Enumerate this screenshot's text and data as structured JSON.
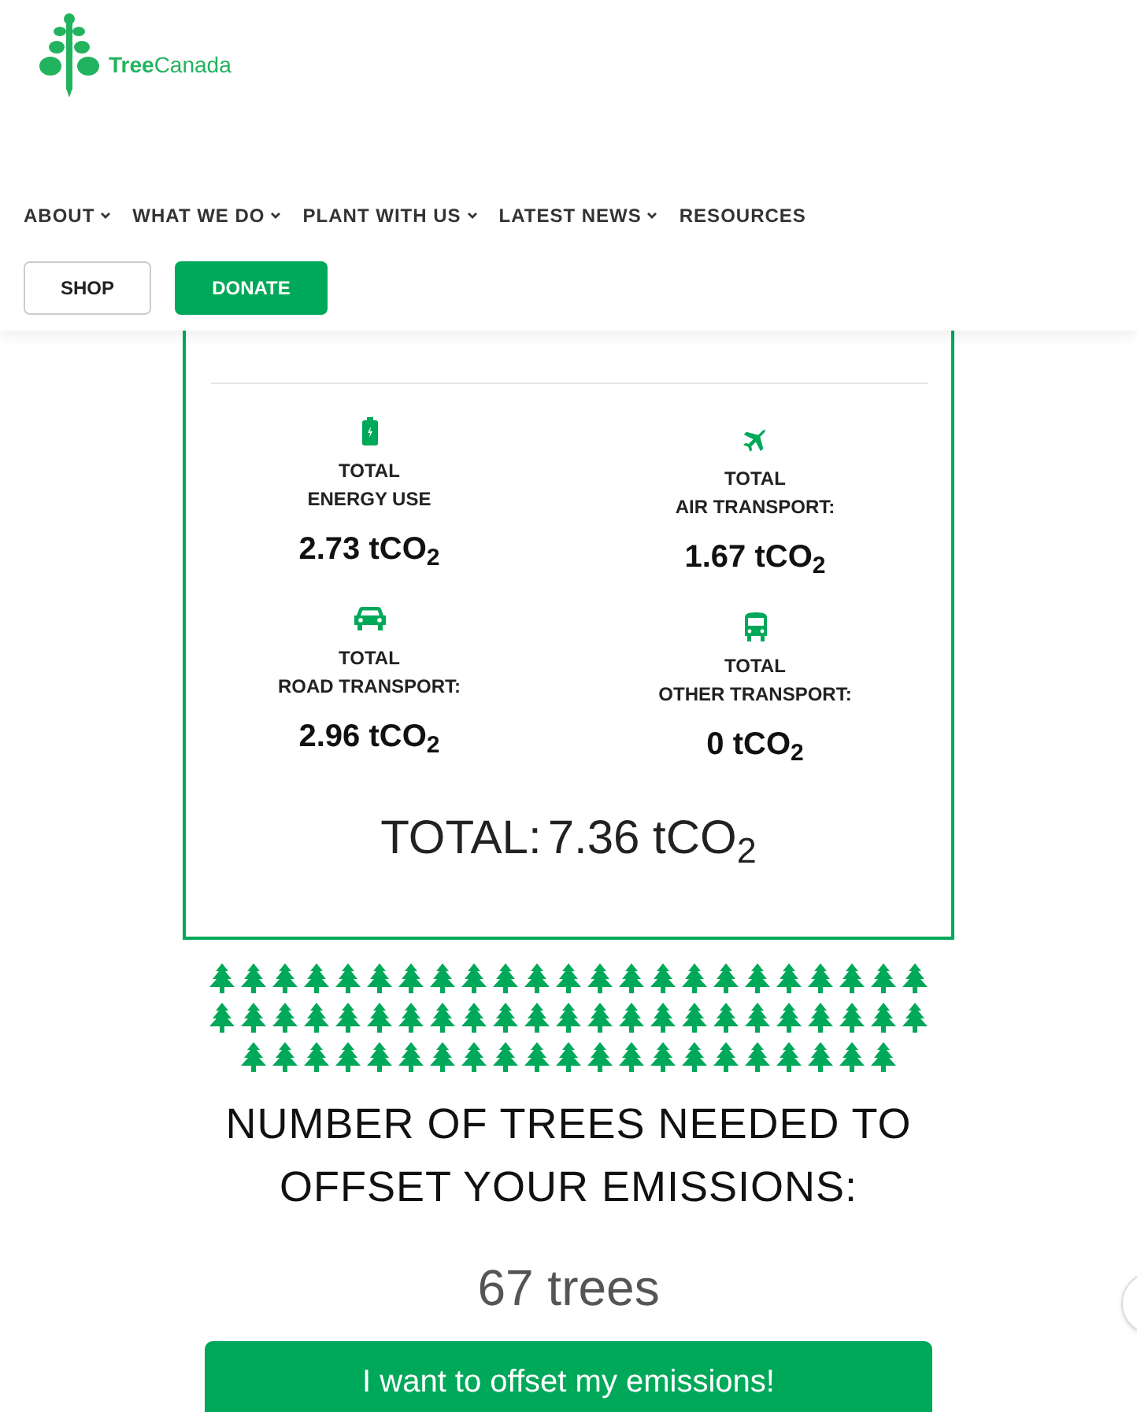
{
  "header": {
    "logo_text": "**Tree**Canada",
    "nav": [
      {
        "label": "ABOUT",
        "dropdown": true
      },
      {
        "label": "WHAT WE DO",
        "dropdown": true
      },
      {
        "label": "PLANT WITH US",
        "dropdown": true
      },
      {
        "label": "LATEST NEWS",
        "dropdown": true
      },
      {
        "label": "RESOURCES",
        "dropdown": false
      }
    ],
    "buttons": [
      {
        "label": "SHOP",
        "kind": "outline"
      },
      {
        "label": "DONATE",
        "kind": "filled"
      }
    ]
  },
  "results": [
    {
      "kind": "energy",
      "title": "TOTAL",
      "subtitle": "ENERGY USE",
      "value": "2.73 tCO$_{2}$"
    },
    {
      "kind": "air",
      "title": "TOTAL",
      "subtitle": "AIR TRANSPORT:",
      "value": "1.67 tCO$_{2}$"
    },
    {
      "kind": "road",
      "title": "TOTAL",
      "subtitle": "ROAD TRANSPORT:",
      "value": "2.96 tCO$_{2}$"
    },
    {
      "kind": "other",
      "title": "TOTAL",
      "subtitle": "OTHER TRANSPORT:",
      "value": "0 tCO$_{2}$"
    }
  ],
  "total": {
    "label": "TOTAL:",
    "value": "7.36 tCO$_{2}$"
  },
  "trees": {
    "heading_lines": [
      "NUMBER OF TREES NEEDED TO",
      "OFFSET YOUR EMISSIONS:"
    ],
    "count": "67 trees",
    "button": "I want to offset my emissions!"
  }
}
